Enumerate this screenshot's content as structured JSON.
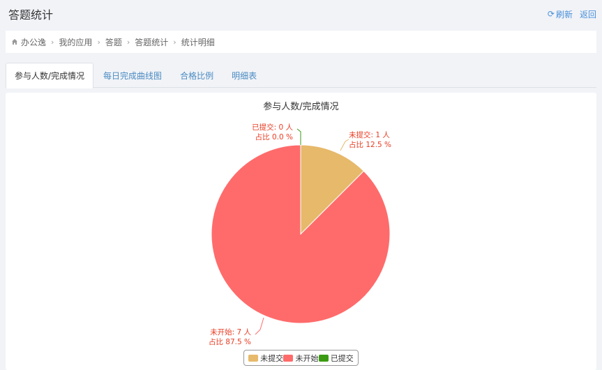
{
  "header": {
    "title": "答题统计",
    "refresh_label": "刷新",
    "back_label": "返回"
  },
  "breadcrumb": {
    "items": [
      "办公逸",
      "我的应用",
      "答题",
      "答题统计",
      "统计明细"
    ]
  },
  "tabs": [
    {
      "label": "参与人数/完成情况",
      "active": true
    },
    {
      "label": "每日完成曲线图",
      "active": false
    },
    {
      "label": "合格比例",
      "active": false
    },
    {
      "label": "明细表",
      "active": false
    }
  ],
  "colors": {
    "accent": "#4a90d9",
    "not_submitted": "#e6b96b",
    "not_started": "#ff6b6b",
    "submitted": "#3a9b12",
    "label_text": "#e83c23"
  },
  "chart_data": {
    "type": "pie",
    "title": "参与人数/完成情况",
    "legend_position": "bottom",
    "slices": [
      {
        "name": "未提交",
        "value": 1,
        "percent": 12.5,
        "color": "#e6b96b",
        "label_line1": "未提交: 1 人",
        "label_line2": "占比 12.5 %"
      },
      {
        "name": "未开始",
        "value": 7,
        "percent": 87.5,
        "color": "#ff6b6b",
        "label_line1": "未开始: 7 人",
        "label_line2": "占比 87.5 %"
      },
      {
        "name": "已提交",
        "value": 0,
        "percent": 0.0,
        "color": "#3a9b12",
        "label_line1": "已提交: 0 人",
        "label_line2": "占比 0.0 %"
      }
    ],
    "legend": [
      "未提交",
      "未开始",
      "已提交"
    ]
  }
}
